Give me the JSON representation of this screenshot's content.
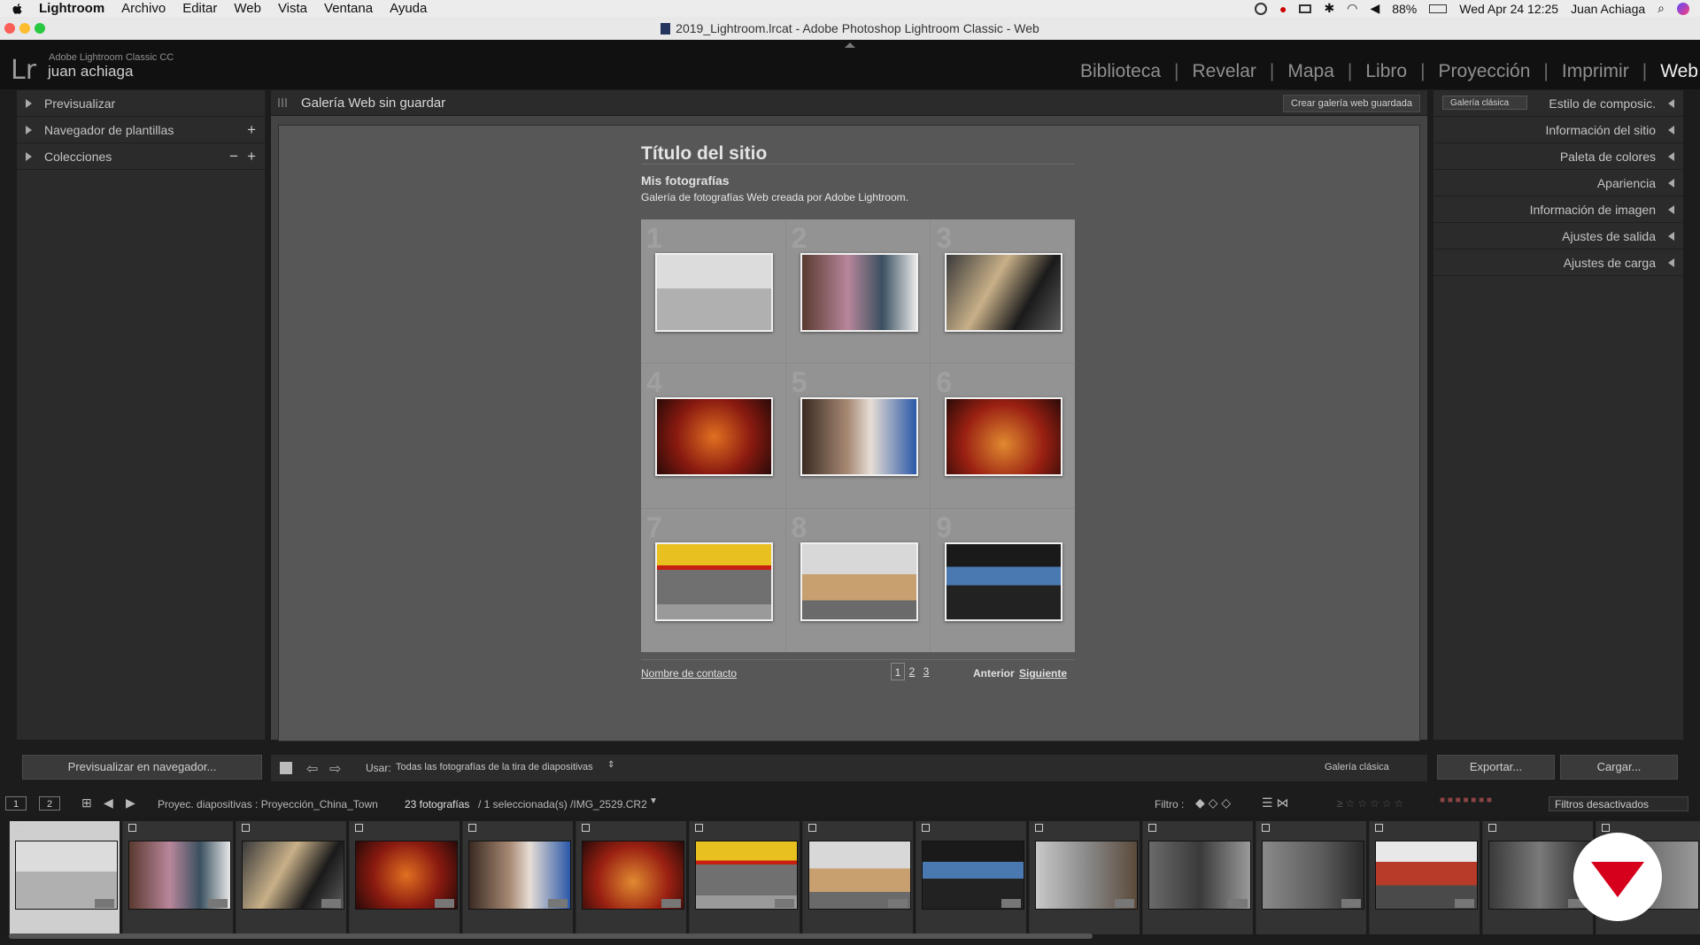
{
  "macos_menubar": {
    "app_name": "Lightroom",
    "menus": [
      "Archivo",
      "Editar",
      "Web",
      "Vista",
      "Ventana",
      "Ayuda"
    ],
    "battery": "88%",
    "datetime": "Wed Apr 24  12:25",
    "user": "Juan Achiaga"
  },
  "window": {
    "title": "2019_Lightroom.lrcat - Adobe Photoshop Lightroom Classic - Web"
  },
  "identity": {
    "logo": "Lr",
    "product": "Adobe Lightroom Classic CC",
    "user": "juan achiaga"
  },
  "modules": [
    {
      "label": "Biblioteca",
      "active": false
    },
    {
      "label": "Revelar",
      "active": false
    },
    {
      "label": "Mapa",
      "active": false
    },
    {
      "label": "Libro",
      "active": false
    },
    {
      "label": "Proyección",
      "active": false
    },
    {
      "label": "Imprimir",
      "active": false
    },
    {
      "label": "Web",
      "active": true
    }
  ],
  "left_panel": {
    "items": [
      {
        "label": "Previsualizar"
      },
      {
        "label": "Navegador de plantillas",
        "action": "+"
      },
      {
        "label": "Colecciones",
        "action": "+",
        "action2": "−"
      }
    ],
    "preview_button": "Previsualizar en navegador..."
  },
  "center": {
    "header_title": "Galería Web sin guardar",
    "create_button": "Crear galería web guardada",
    "gallery": {
      "site_title": "Título del sitio",
      "collection_title": "Mis fotografías",
      "description": "Galería de fotografías Web creada por Adobe Lightroom.",
      "cell_numbers": [
        "1",
        "2",
        "3",
        "4",
        "5",
        "6",
        "7",
        "8",
        "9"
      ],
      "contact": "Nombre de contacto",
      "pages": [
        "1",
        "2",
        "3"
      ],
      "previous": "Anterior",
      "next": "Siguiente"
    }
  },
  "toolbar": {
    "use_label": "Usar:",
    "use_value": "Todas las fotografías de la tira de diapositivas",
    "layout_name": "Galería clásica"
  },
  "right_panel": {
    "style_dropdown": "Galería clásica",
    "items": [
      "Estilo de composic.",
      "Información del sitio",
      "Paleta de colores",
      "Apariencia",
      "Información de imagen",
      "Ajustes de salida",
      "Ajustes de carga"
    ],
    "export_button": "Exportar...",
    "upload_button": "Cargar..."
  },
  "filmstrip_bar": {
    "monitor1": "1",
    "monitor2": "2",
    "source": "Proyec. diapositivas : Proyección_China_Town",
    "count": "23 fotografías",
    "selection": "/ 1 seleccionada(s) /IMG_2529.CR2",
    "filter_label": "Filtro :",
    "filters_state": "Filtros desactivados"
  },
  "colors": {
    "accent": "#d6001c",
    "panel": "#2b2b2b",
    "background": "#1c1c1c"
  }
}
